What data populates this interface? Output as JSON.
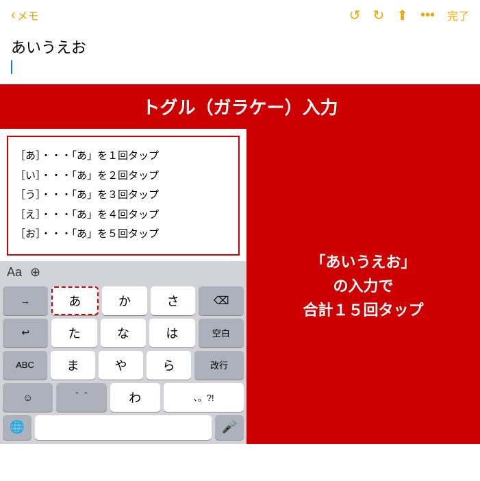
{
  "nav": {
    "back_label": "メモ",
    "done_label": "完了"
  },
  "note": {
    "title": "あいうえお"
  },
  "banner": {
    "title": "トグル（ガラケー）入力"
  },
  "instructions": {
    "rows": [
      "［あ］・・・「あ」を１回タップ",
      "［い］・・・「あ」を２回タップ",
      "［う］・・・「あ」を３回タップ",
      "［え］・・・「あ」を４回タップ",
      "［お］・・・「あ」を５回タップ"
    ]
  },
  "right_panel": {
    "text": "「あいうえお」\nの入力で\n合計１５回タップ"
  },
  "keyboard": {
    "rows": [
      [
        "→",
        "あ",
        "か",
        "さ",
        "⌫"
      ],
      [
        "↩",
        "た",
        "な",
        "は",
        "空白"
      ],
      [
        "ABC",
        "ま",
        "や",
        "ら",
        "改行"
      ],
      [
        "☺",
        "＾＾",
        "わ",
        "、。?!"
      ]
    ],
    "bottom": [
      "🌐",
      "",
      "🎤"
    ]
  }
}
